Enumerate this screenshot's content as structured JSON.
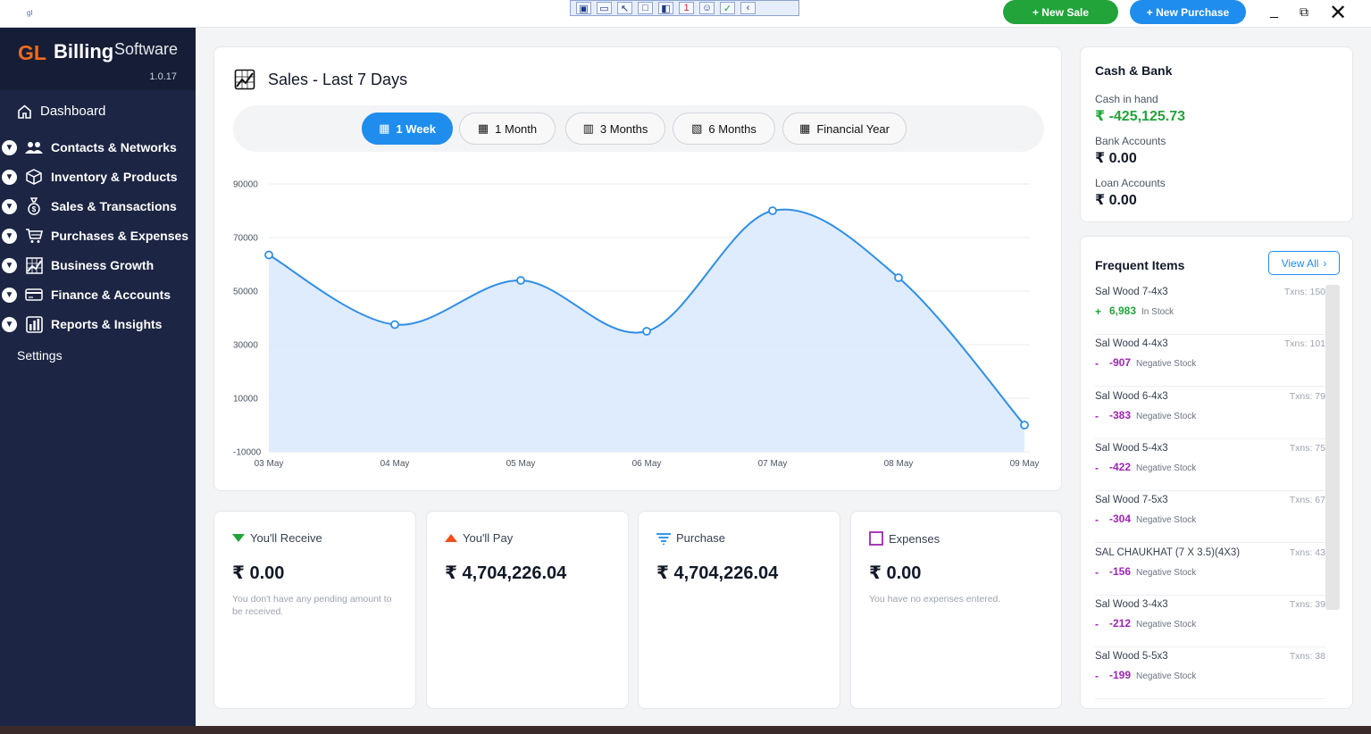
{
  "topbar": {
    "app_icon_text": "gl",
    "new_sale": "+ New Sale",
    "new_purchase": "+ New Purchase",
    "minimize": "_",
    "restore": "⧉",
    "close": "✕",
    "recorder_count": "1"
  },
  "brand": {
    "gl": "GL",
    "billing": "Billing",
    "software": "Software",
    "version": "1.0.17"
  },
  "sidebar": {
    "dashboard": "Dashboard",
    "items": [
      {
        "label": "Contacts & Networks",
        "icon": "contacts-icon"
      },
      {
        "label": "Inventory & Products",
        "icon": "box-icon"
      },
      {
        "label": "Sales & Transactions",
        "icon": "money-bag-icon"
      },
      {
        "label": "Purchases & Expenses",
        "icon": "cart-icon"
      },
      {
        "label": "Business Growth",
        "icon": "growth-chart-icon"
      },
      {
        "label": "Finance & Accounts",
        "icon": "card-icon"
      },
      {
        "label": "Reports & Insights",
        "icon": "bar-chart-icon"
      }
    ],
    "settings": "Settings"
  },
  "sales_chart": {
    "title": "Sales - Last 7 Days",
    "tabs": [
      "1 Week",
      "1 Month",
      "3 Months",
      "6 Months",
      "Financial Year"
    ],
    "active_tab": "1 Week",
    "colors": {
      "line": "#2f8ee5",
      "fill": "#dbeafe"
    }
  },
  "chart_data": {
    "type": "area",
    "x": [
      "03 May",
      "04 May",
      "05 May",
      "06 May",
      "07 May",
      "08 May",
      "09 May"
    ],
    "values": [
      63500,
      37500,
      54000,
      35000,
      80000,
      55000,
      0
    ],
    "ylim": [
      -10000,
      90000
    ],
    "yticks": [
      90000,
      70000,
      50000,
      30000,
      10000,
      -10000
    ],
    "grid": true,
    "title": "Sales - Last 7 Days",
    "xlabel": "",
    "ylabel": ""
  },
  "summary": [
    {
      "title": "You'll Receive",
      "amount": "₹ 0.00",
      "note": "You don't have any pending amount to be received.",
      "icon": "triangle-down-icon",
      "color": "#22a43a"
    },
    {
      "title": "You'll Pay",
      "amount": "₹ 4,704,226.04",
      "note": "",
      "icon": "triangle-up-icon",
      "color": "#ef4e1b"
    },
    {
      "title": "Purchase",
      "amount": "₹ 4,704,226.04",
      "note": "",
      "icon": "filter-lines-icon",
      "color": "#1f8ded"
    },
    {
      "title": "Expenses",
      "amount": "₹ 0.00",
      "note": "You have no expenses entered.",
      "icon": "square-icon",
      "color": "#9c27b0"
    }
  ],
  "cash_bank": {
    "title": "Cash & Bank",
    "cash_label": "Cash in hand",
    "cash_value": "₹ -425,125.73",
    "bank_label": "Bank Accounts",
    "bank_value": "₹ 0.00",
    "loan_label": "Loan Accounts",
    "loan_value": "₹ 0.00"
  },
  "frequent_items": {
    "title": "Frequent Items",
    "view_all": "View All",
    "items": [
      {
        "name": "Sal Wood 7-4x3",
        "txns": "Txns: 150",
        "sign": "+",
        "qty": "6,983",
        "status": "In Stock",
        "positive": true
      },
      {
        "name": "Sal Wood 4-4x3",
        "txns": "Txns: 101",
        "sign": "-",
        "qty": "-907",
        "status": "Negative Stock",
        "positive": false
      },
      {
        "name": "Sal Wood 6-4x3",
        "txns": "Txns: 79",
        "sign": "-",
        "qty": "-383",
        "status": "Negative Stock",
        "positive": false
      },
      {
        "name": "Sal Wood 5-4x3",
        "txns": "Txns: 75",
        "sign": "-",
        "qty": "-422",
        "status": "Negative Stock",
        "positive": false
      },
      {
        "name": "Sal Wood 7-5x3",
        "txns": "Txns: 67",
        "sign": "-",
        "qty": "-304",
        "status": "Negative Stock",
        "positive": false
      },
      {
        "name": "SAL CHAUKHAT (7 X 3.5)(4X3)",
        "txns": "Txns: 43",
        "sign": "-",
        "qty": "-156",
        "status": "Negative Stock",
        "positive": false
      },
      {
        "name": "Sal Wood 3-4x3",
        "txns": "Txns: 39",
        "sign": "-",
        "qty": "-212",
        "status": "Negative Stock",
        "positive": false
      },
      {
        "name": "Sal Wood 5-5x3",
        "txns": "Txns: 38",
        "sign": "-",
        "qty": "-199",
        "status": "Negative Stock",
        "positive": false
      }
    ]
  }
}
